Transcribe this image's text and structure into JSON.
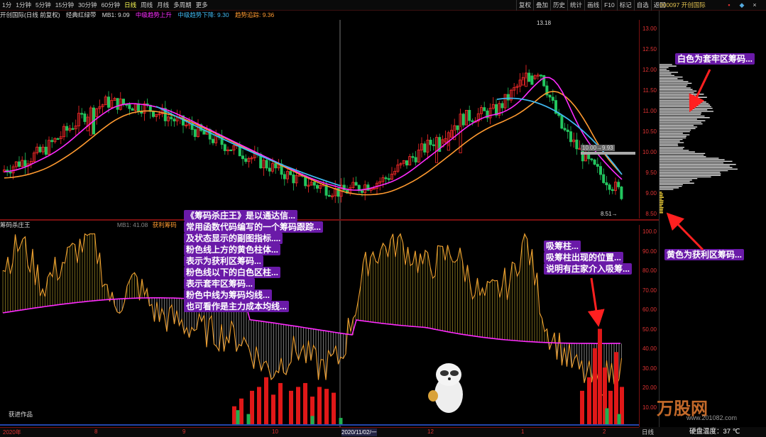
{
  "toolbar": {
    "items": [
      "1分",
      "1分钟",
      "5分钟",
      "15分钟",
      "30分钟",
      "60分钟",
      "日线",
      "周线",
      "月线",
      "多周期",
      "更多"
    ],
    "active_index": 6,
    "right_buttons": [
      "复权",
      "叠加",
      "历史",
      "统计",
      "画线",
      "F10",
      "标记",
      "自选",
      "返回"
    ],
    "stock_code": "000097 开创国际"
  },
  "title_row": {
    "stock": "开创国际(日线 前复权)",
    "indicator": "经典红绿带",
    "ma": "MB1: 9.09",
    "green_up": "中级趋势上升",
    "blue_down": "中级趋势下降: 9.30",
    "trend_line": "趋势追踪: 9.36"
  },
  "price_axis": [
    "13.00",
    "12.50",
    "12.00",
    "11.50",
    "11.00",
    "10.50",
    "10.00",
    "9.50",
    "9.00",
    "8.50"
  ],
  "price_annotations": {
    "high": "13.18",
    "mid": "10.00→9.93",
    "low": "8.51→"
  },
  "indicator": {
    "title": "筹码杀庄王",
    "title_params": "MB1: 41.08",
    "profit_label": "获利筹码",
    "left_label": "获进作品"
  },
  "indicator_axis": [
    "100.0",
    "90.00",
    "80.00",
    "70.00",
    "60.00",
    "50.00",
    "40.00",
    "30.00",
    "20.00",
    "10.00"
  ],
  "notes": {
    "left": [
      "《筹码杀庄王》是以通达信...",
      "常用函数代码编写的一个筹码跟踪...",
      "及状态显示的副图指标....",
      "粉色线上方的黄色柱体...",
      "表示为获利区筹码...",
      "粉色线以下的白色区柱...",
      "表示套牢区筹码...",
      "粉色中线为筹码均线...",
      "也可看作是主力成本均线..."
    ],
    "right": [
      "吸筹柱...",
      "吸筹柱出现的位置...",
      "说明有庄家介入吸筹..."
    ],
    "chip_white": "白色为套牢区筹码...",
    "chip_yellow": "黄色为获利区筹码..."
  },
  "date_axis": {
    "labels": [
      "2020年",
      "8",
      "9",
      "10",
      "2020/11/02/一",
      "12",
      "1",
      "2"
    ],
    "period": "日线"
  },
  "status": {
    "temp": "硬盘温度：37 ℃",
    "watermark": "万股网",
    "url": "www.201082.com"
  },
  "colors": {
    "up": "#ff2a2a",
    "down": "#22c55e",
    "ma_pink": "#ff2bff",
    "ma_blue": "#3fb8f0",
    "ma_orange": "#ff9a30",
    "axis_red": "#d33333",
    "note_bg": "#6a1aa8",
    "chip_white": "#f0f0f0",
    "chip_yellow": "#f3d33a"
  }
}
